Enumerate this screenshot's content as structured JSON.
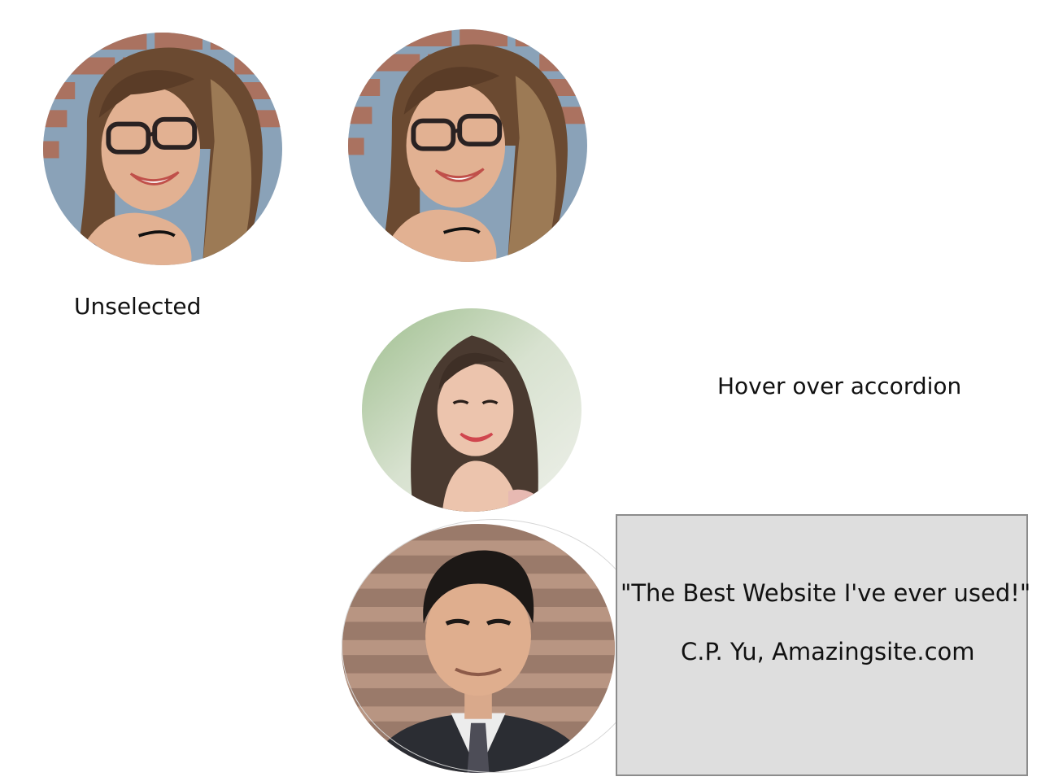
{
  "captions": {
    "unselected": "Unselected",
    "hover": "Hover over accordion"
  },
  "testimonial": {
    "quote": "\"The Best Website I've ever used!\"",
    "author": "C.P. Yu, Amazingsite.com"
  },
  "colors": {
    "quote_box_bg": "#dedede",
    "quote_box_border": "#8c8c8c"
  }
}
